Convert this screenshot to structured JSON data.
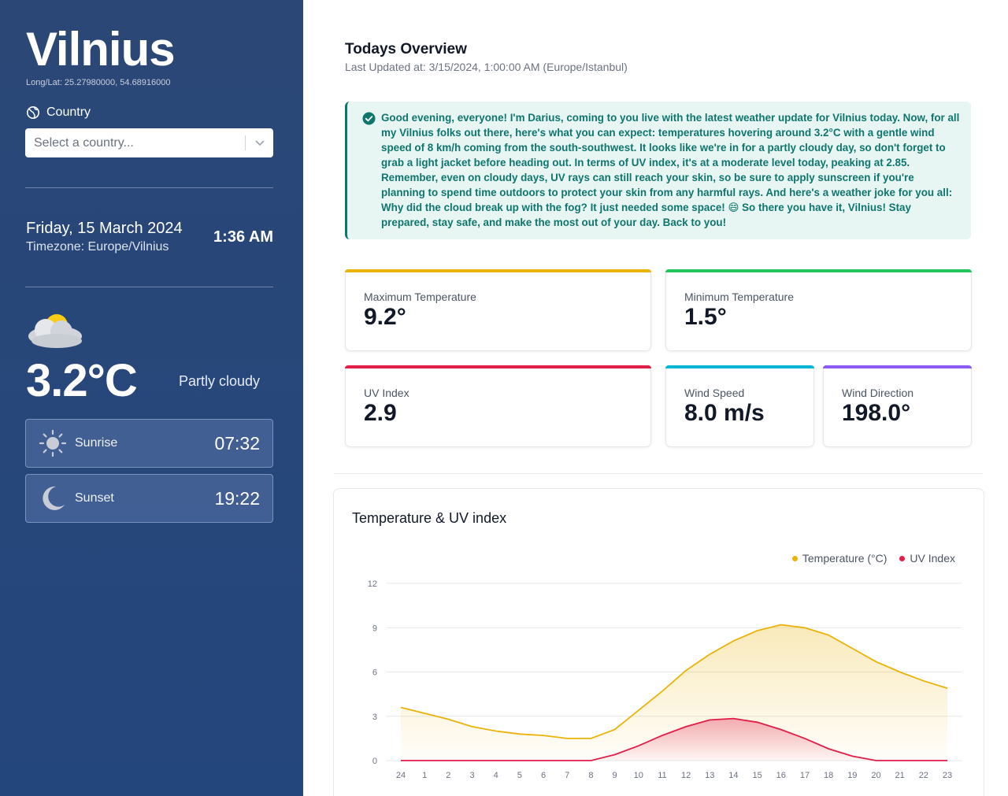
{
  "sidebar": {
    "city": "Vilnius",
    "coords": "Long/Lat: 25.27980000, 54.68916000",
    "country_label": "Country",
    "country_placeholder": "Select a country...",
    "date": "Friday, 15 March 2024",
    "timezone": "Timezone: Europe/Vilnius",
    "time": "1:36 AM",
    "temperature": "3.2°C",
    "condition": "Partly cloudy",
    "sunrise_label": "Sunrise",
    "sunrise_time": "07:32",
    "sunset_label": "Sunset",
    "sunset_time": "19:22"
  },
  "main": {
    "title": "Todays Overview",
    "last_updated": "Last Updated at: 3/15/2024, 1:00:00 AM (Europe/Istanbul)",
    "report": "Good evening, everyone! I'm Darius, coming to you live with the latest weather update for Vilnius today. Now, for all my Vilnius folks out there, here's what you can expect: temperatures hovering around 3.2°C with a gentle wind speed of 8 km/h coming from the south-southwest. It looks like we're in for a partly cloudy day, so don't forget to grab a light jacket before heading out. In terms of UV index, it's at a moderate level today, peaking at 2.85. Remember, even on cloudy days, UV rays can still reach your skin, so be sure to apply sunscreen if you're planning to spend time outdoors to protect your skin from any harmful rays. And here's a weather joke for you all: Why did the cloud break up with the fog? It just needed some space! 😄 So there you have it, Vilnius! Stay prepared, stay safe, and make the most out of your day. Back to you!",
    "stats": {
      "max_temp_label": "Maximum Temperature",
      "max_temp": "9.2°",
      "min_temp_label": "Minimum Temperature",
      "min_temp": "1.5°",
      "uv_label": "UV Index",
      "uv": "2.9",
      "wind_speed_label": "Wind Speed",
      "wind_speed": "8.0 m/s",
      "wind_dir_label": "Wind Direction",
      "wind_dir": "198.0°"
    },
    "colors": {
      "max": "#eab308",
      "min": "#22c55e",
      "uv": "#e11d48",
      "wind": "#06b6d4",
      "dir": "#8b5cf6"
    }
  },
  "chart_data": {
    "type": "area",
    "title": "Temperature & UV index",
    "categories": [
      "24",
      "1",
      "2",
      "3",
      "4",
      "5",
      "6",
      "7",
      "8",
      "9",
      "10",
      "11",
      "12",
      "13",
      "14",
      "15",
      "16",
      "17",
      "18",
      "19",
      "20",
      "21",
      "22",
      "23"
    ],
    "ylim": [
      0,
      12
    ],
    "yticks": [
      "0",
      "3",
      "6",
      "9",
      "12"
    ],
    "grid": true,
    "legend_position": "top-right",
    "series": [
      {
        "name": "Temperature (°C)",
        "color": "#eab308",
        "values": [
          3.6,
          3.2,
          2.8,
          2.3,
          2.0,
          1.8,
          1.7,
          1.5,
          1.5,
          2.1,
          3.4,
          4.7,
          6.1,
          7.2,
          8.1,
          8.8,
          9.2,
          9.0,
          8.5,
          7.6,
          6.7,
          6.0,
          5.4,
          4.9
        ]
      },
      {
        "name": "UV Index",
        "color": "#e11d48",
        "values": [
          0,
          0,
          0,
          0,
          0,
          0,
          0,
          0,
          0,
          0.4,
          1.0,
          1.7,
          2.3,
          2.75,
          2.85,
          2.6,
          2.1,
          1.5,
          0.8,
          0.3,
          0,
          0,
          0,
          0
        ]
      }
    ]
  }
}
